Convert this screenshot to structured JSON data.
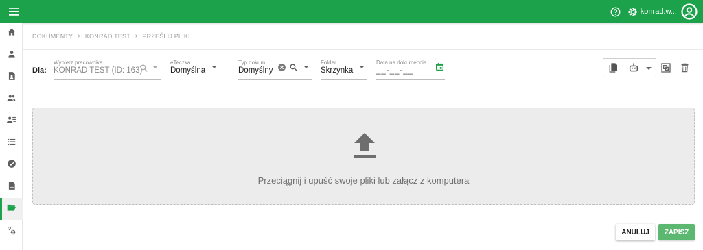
{
  "topbar": {
    "user_name": "konrad.w...",
    "accent": "#1ca24a"
  },
  "breadcrumb": [
    "DOKUMENTY",
    "KONRAD TEST",
    "PRZEŚLIJ PLIKI"
  ],
  "form": {
    "dla_label": "Dla:",
    "employee": {
      "label": "Wybierz pracownika",
      "value": "KONRAD TEST (ID: 163)"
    },
    "eteczka": {
      "label": "eTeczka",
      "value": "Domyślna"
    },
    "doc_type": {
      "label": "Typ dokum...",
      "value": "Domyślny"
    },
    "folder": {
      "label": "Folder",
      "value": "Skrzynka"
    },
    "date": {
      "label": "Data na dokumencie",
      "placeholder": "__-__-__"
    }
  },
  "dropzone": {
    "text": "Przeciągnij i upuść swoje pliki lub załącz z komputera"
  },
  "actions": {
    "cancel": "ANULUJ",
    "save": "ZAPISZ"
  },
  "sidebar": [
    "home-icon",
    "person-icon",
    "person-document-icon",
    "group-icon",
    "person-list-icon",
    "list-icon",
    "check-circle-icon",
    "document-icon",
    "folder-open-icon",
    "settings-icon"
  ]
}
